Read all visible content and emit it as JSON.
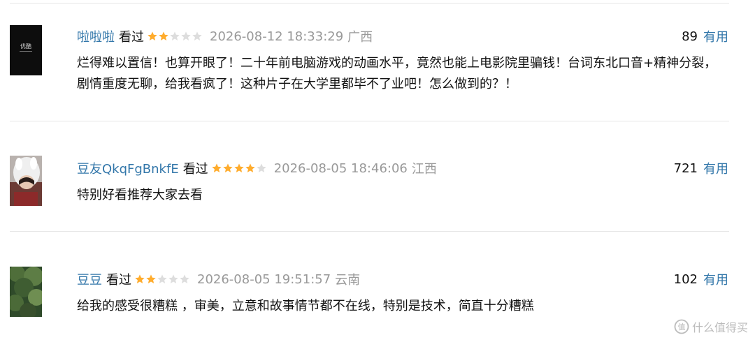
{
  "reviews": [
    {
      "author": "啦啦啦",
      "status": "看过",
      "rating": 2,
      "max_rating": 5,
      "time": "2026-08-12 18:33:29",
      "region": "广西",
      "votes": "89",
      "useful_label": "有用",
      "avatar_text": "优酷",
      "content": "烂得难以置信！也算开眼了！二十年前电脑游戏的动画水平，竟然也能上电影院里骗钱！台词东北口音+精神分裂，剧情重度无聊，给我看疯了！这种片子在大学里都毕不了业吧！怎么做到的？！"
    },
    {
      "author": "豆友QkqFgBnkfE",
      "status": "看过",
      "rating": 4,
      "max_rating": 5,
      "time": "2026-08-05 18:46:06",
      "region": "江西",
      "votes": "721",
      "useful_label": "有用",
      "content": "特别好看推荐大家去看"
    },
    {
      "author": "豆豆",
      "status": "看过",
      "rating": 2,
      "max_rating": 5,
      "time": "2026-08-05 19:51:57",
      "region": "云南",
      "votes": "102",
      "useful_label": "有用",
      "content": "给我的感受很糟糕 ，审美，立意和故事情节都不在线，特别是技术，简直十分糟糕"
    }
  ],
  "watermark": "什么值得买",
  "colors": {
    "link": "#3377aa",
    "star_on": "#ffac2d",
    "star_off": "#dddddd",
    "meta": "#999999"
  }
}
